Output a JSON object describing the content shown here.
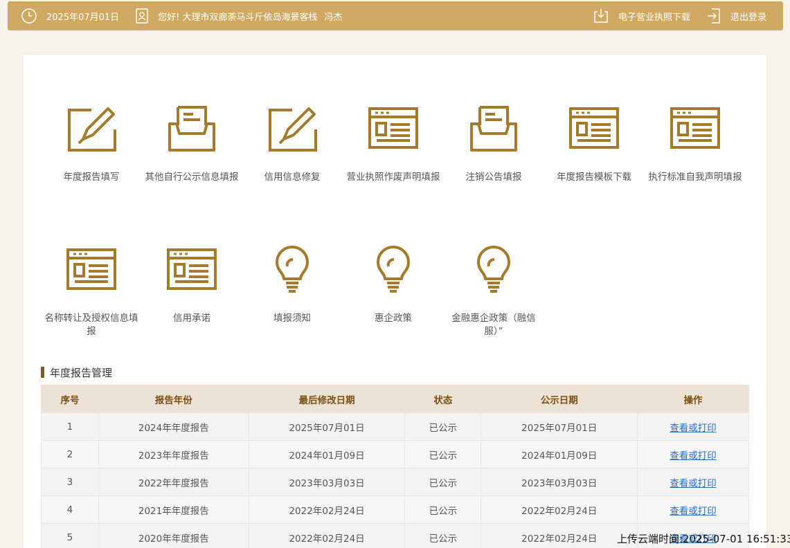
{
  "topbar": {
    "date": "2025年07月01日",
    "greeting": "您好! 大理市双廊荼马斗斤依岛海景客栈",
    "user_name": "冯杰",
    "license_download": "电子营业执照下载",
    "logout": "退出登录"
  },
  "tiles": [
    {
      "label": "年度报告填写",
      "icon": "pencil-icon"
    },
    {
      "label": "其他自行公示信息填报",
      "icon": "inbox-tray-icon"
    },
    {
      "label": "信用信息修复",
      "icon": "pencil-icon"
    },
    {
      "label": "营业执照作废声明填报",
      "icon": "browser-window-icon"
    },
    {
      "label": "注销公告填报",
      "icon": "inbox-tray-icon"
    },
    {
      "label": "年度报告模板下载",
      "icon": "browser-window-icon"
    },
    {
      "label": "执行标准自我声明填报",
      "icon": "browser-window-icon"
    },
    {
      "label": "名称转让及授权信息填报",
      "icon": "browser-window-icon"
    },
    {
      "label": "信用承诺",
      "icon": "browser-window-icon"
    },
    {
      "label": "填报须知",
      "icon": "lightbulb-icon"
    },
    {
      "label": "惠企政策",
      "icon": "lightbulb-icon"
    },
    {
      "label": "金融惠企政策（融信服）”",
      "icon": "lightbulb-icon"
    }
  ],
  "section": {
    "title": "年度报告管理"
  },
  "table": {
    "headers": [
      "序号",
      "报告年份",
      "最后修改日期",
      "状态",
      "公示日期",
      "操作"
    ],
    "rows": [
      [
        "1",
        "2024年年度报告",
        "2025年07月01日",
        "已公示",
        "2025年07月01日",
        "查看或打印"
      ],
      [
        "2",
        "2023年年度报告",
        "2024年01月09日",
        "已公示",
        "2024年01月09日",
        "查看或打印"
      ],
      [
        "3",
        "2022年年度报告",
        "2023年03月03日",
        "已公示",
        "2023年03月03日",
        "查看或打印"
      ],
      [
        "4",
        "2021年年度报告",
        "2022年02月24日",
        "已公示",
        "2022年02月24日",
        "查看或打印"
      ],
      [
        "5",
        "2020年年度报告",
        "2022年02月24日",
        "已公示",
        "2022年02月24日",
        "查看或打印"
      ]
    ]
  },
  "watermark": "上传云端时间:2025-07-01 16:51:33",
  "colors": {
    "accent": "#cfa863",
    "icon": "#a57a2a",
    "link": "#2a6cc8"
  }
}
